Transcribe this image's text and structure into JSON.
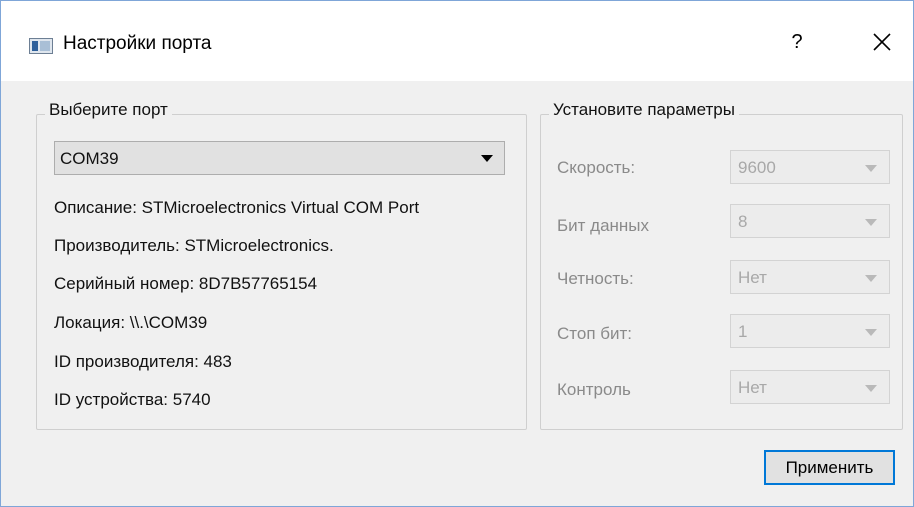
{
  "window": {
    "title": "Настройки порта",
    "help_label": "?"
  },
  "port_group": {
    "title": "Выберите порт",
    "selected_port": "COM39",
    "info": [
      "Описание: STMicroelectronics Virtual COM Port",
      "Производитель: STMicroelectronics.",
      "Серийный номер: 8D7B57765154",
      "Локация: \\\\.\\COM39",
      "ID производителя: 483",
      "ID устройства: 5740"
    ]
  },
  "params_group": {
    "title": "Установите параметры",
    "params": [
      {
        "label": "Скорость:",
        "value": "9600"
      },
      {
        "label": "Бит данных",
        "value": "8"
      },
      {
        "label": "Четность:",
        "value": "Нет"
      },
      {
        "label": "Стоп бит:",
        "value": "1"
      },
      {
        "label": "Контроль",
        "value": "Нет"
      }
    ]
  },
  "apply_button": {
    "label": "Применить"
  },
  "icons": {
    "app": "window-icon",
    "close": "close-icon",
    "dropdown": "chevron-down-icon"
  },
  "colors": {
    "accent": "#0078d7",
    "window_bg": "#f0f0f0",
    "disabled_text": "#8a8a8a"
  }
}
